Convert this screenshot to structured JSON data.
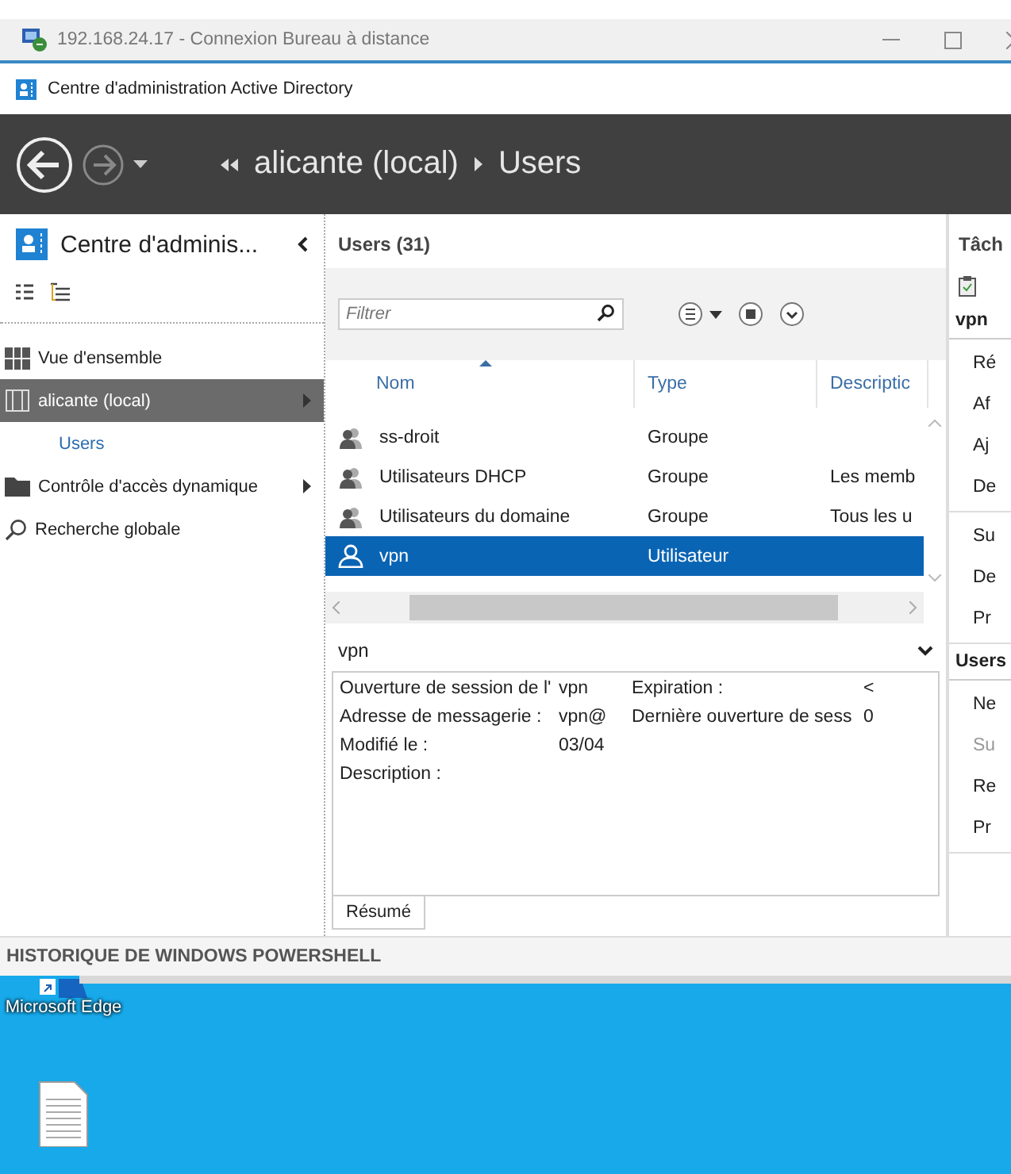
{
  "remote_window": {
    "title": "192.168.24.17 - Connexion Bureau à distance"
  },
  "app": {
    "title": "Centre d'administration Active Directory"
  },
  "breadcrumb": [
    "alicante (local)",
    "Users"
  ],
  "nav": {
    "title": "Centre d'adminis...",
    "items": [
      {
        "label": "Vue d'ensemble",
        "kind": "overview",
        "selected": false,
        "expandable": false
      },
      {
        "label": "alicante (local)",
        "kind": "domain",
        "selected": true,
        "expandable": true,
        "children": [
          {
            "label": "Users",
            "selected": false,
            "expandable": false
          }
        ]
      },
      {
        "label": "Contrôle d'accès dynamique",
        "kind": "folder",
        "selected": false,
        "expandable": true
      },
      {
        "label": "Recherche globale",
        "kind": "search",
        "selected": false,
        "expandable": false
      }
    ]
  },
  "list": {
    "title": "Users (31)",
    "filter": {
      "placeholder": "Filtrer"
    },
    "columns": [
      {
        "label": "Nom",
        "sorted": true
      },
      {
        "label": "Type",
        "sorted": false
      },
      {
        "label": "Descriptic",
        "sorted": false
      }
    ],
    "rows": [
      {
        "kind": "group",
        "name": "ss-droit",
        "type": "Groupe",
        "description": "",
        "selected": false
      },
      {
        "kind": "group",
        "name": "Utilisateurs DHCP",
        "type": "Groupe",
        "description": "Les memb",
        "selected": false
      },
      {
        "kind": "group",
        "name": "Utilisateurs du domaine",
        "type": "Groupe",
        "description": "Tous les u",
        "selected": false
      },
      {
        "kind": "user",
        "name": "vpn",
        "type": "Utilisateur",
        "description": "",
        "selected": true
      }
    ]
  },
  "preview": {
    "title": "vpn",
    "fields": [
      {
        "label": "Ouverture de session de l'",
        "value": "vpn",
        "label2": "Expiration :",
        "value2": "<"
      },
      {
        "label": "Adresse de messagerie :",
        "value": "vpn@",
        "label2": "Dernière ouverture de sess",
        "value2": "0"
      },
      {
        "label": "Modifié le :",
        "value": "03/04"
      },
      {
        "label": "Description :"
      }
    ],
    "tabs": [
      {
        "label": "Résumé",
        "selected": true
      }
    ]
  },
  "tasks": {
    "title": "Tâch",
    "sections": [
      {
        "title": "vpn",
        "groups": [
          [
            {
              "label": "Ré",
              "disabled": false
            },
            {
              "label": "Af",
              "disabled": false
            },
            {
              "label": "Aj",
              "disabled": false
            },
            {
              "label": "De",
              "disabled": false
            }
          ],
          [
            {
              "label": "Su",
              "disabled": false
            },
            {
              "label": "De",
              "disabled": false
            },
            {
              "label": "Pr",
              "disabled": false
            }
          ]
        ]
      },
      {
        "title": "Users",
        "groups": [
          [
            {
              "label": "Ne",
              "disabled": false
            },
            {
              "label": "Su",
              "disabled": true
            },
            {
              "label": "Re",
              "disabled": false
            },
            {
              "label": "Pr",
              "disabled": false
            }
          ]
        ]
      }
    ]
  },
  "powershell": {
    "title": "HISTORIQUE DE WINDOWS POWERSHELL"
  },
  "desktop": {
    "icons": [
      {
        "kind": "edge",
        "label": "Microsoft Edge"
      },
      {
        "kind": "document"
      }
    ]
  }
}
